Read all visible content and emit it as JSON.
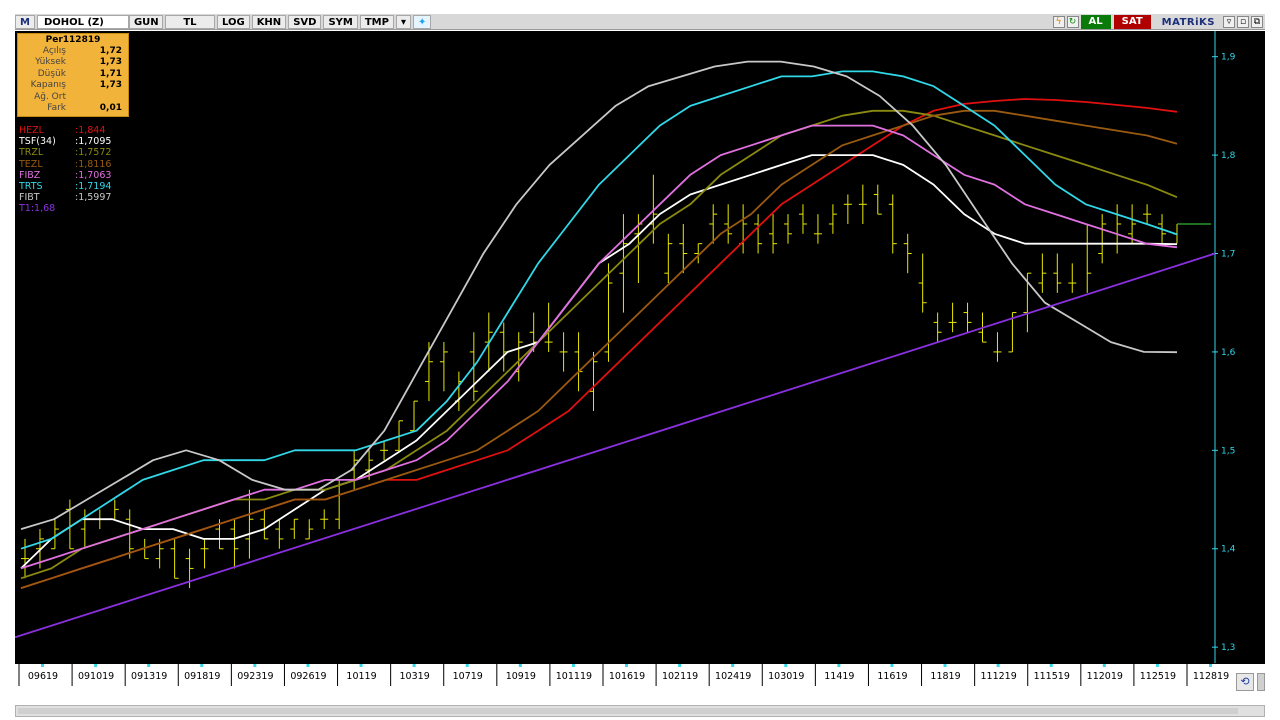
{
  "toolbar": {
    "logo": "M",
    "symbol": "DOHOL (Z)",
    "period": "GUN",
    "currency": "TL",
    "log": "LOG",
    "khn": "KHN",
    "svd": "SVD",
    "sym": "SYM",
    "tmp": "TMP",
    "buy": "AL",
    "sell": "SAT",
    "brand": "MATRiKS"
  },
  "info_box": {
    "title": "Per112819",
    "rows": [
      {
        "label": "Açılış",
        "value": "1,72"
      },
      {
        "label": "Yüksek",
        "value": "1,73"
      },
      {
        "label": "Düşük",
        "value": "1,71"
      },
      {
        "label": "Kapanış",
        "value": "1,73"
      },
      {
        "label": "Ağ. Ort",
        "value": ""
      },
      {
        "label": "Fark",
        "value": "0,01"
      }
    ]
  },
  "legend": [
    {
      "name": "HEZL",
      "value": ":1,844",
      "color": "#e01010"
    },
    {
      "name": "TSF(34)",
      "value": ":1,7095",
      "color": "#ffffff"
    },
    {
      "name": "TRZL",
      "value": ":1,7572",
      "color": "#8a8a10"
    },
    {
      "name": "TEZL",
      "value": ":1,8116",
      "color": "#9a5a10"
    },
    {
      "name": "FIBZ",
      "value": ":1,7063",
      "color": "#e070e0"
    },
    {
      "name": "TRTS",
      "value": ":1,7194",
      "color": "#30d8e8"
    },
    {
      "name": "FIBT",
      "value": ":1,5997",
      "color": "#c8c8c8"
    },
    {
      "name": "T1:1,68",
      "value": "",
      "color": "#8a30e0"
    }
  ],
  "chart_data": {
    "type": "line",
    "ylim": [
      1.29,
      1.92
    ],
    "y_ticks": [
      "1,9",
      "1,8",
      "1,7",
      "1,6",
      "1,5",
      "1,4",
      "1,3"
    ],
    "y_tick_values": [
      1.9,
      1.8,
      1.7,
      1.6,
      1.5,
      1.4,
      1.3
    ],
    "x_tick_labels": [
      "09619",
      "091019",
      "091319",
      "091819",
      "092319",
      "092619",
      "10119",
      "10319",
      "10719",
      "10919",
      "101119",
      "101619",
      "102119",
      "102419",
      "103019",
      "11419",
      "11619",
      "11819",
      "111219",
      "111519",
      "112019",
      "112519",
      "112819"
    ],
    "bar_color": "#e8e800",
    "ohlc": [
      [
        1.39,
        1.41,
        1.37,
        1.39
      ],
      [
        1.4,
        1.42,
        1.38,
        1.41
      ],
      [
        1.4,
        1.43,
        1.4,
        1.42
      ],
      [
        1.44,
        1.45,
        1.4,
        1.4
      ],
      [
        1.42,
        1.44,
        1.4,
        1.43
      ],
      [
        1.43,
        1.44,
        1.42,
        1.43
      ],
      [
        1.43,
        1.45,
        1.43,
        1.44
      ],
      [
        1.43,
        1.44,
        1.39,
        1.4
      ],
      [
        1.4,
        1.41,
        1.39,
        1.39
      ],
      [
        1.39,
        1.41,
        1.38,
        1.4
      ],
      [
        1.4,
        1.41,
        1.37,
        1.37
      ],
      [
        1.39,
        1.4,
        1.36,
        1.38
      ],
      [
        1.4,
        1.41,
        1.38,
        1.4
      ],
      [
        1.42,
        1.43,
        1.4,
        1.4
      ],
      [
        1.42,
        1.43,
        1.38,
        1.4
      ],
      [
        1.41,
        1.46,
        1.39,
        1.43
      ],
      [
        1.43,
        1.44,
        1.41,
        1.41
      ],
      [
        1.42,
        1.43,
        1.4,
        1.41
      ],
      [
        1.42,
        1.43,
        1.41,
        1.43
      ],
      [
        1.41,
        1.43,
        1.41,
        1.42
      ],
      [
        1.43,
        1.44,
        1.42,
        1.43
      ],
      [
        1.43,
        1.47,
        1.42,
        1.47
      ],
      [
        1.48,
        1.5,
        1.46,
        1.49
      ],
      [
        1.48,
        1.5,
        1.47,
        1.49
      ],
      [
        1.5,
        1.51,
        1.49,
        1.5
      ],
      [
        1.5,
        1.53,
        1.5,
        1.53
      ],
      [
        1.52,
        1.55,
        1.52,
        1.55
      ],
      [
        1.57,
        1.61,
        1.55,
        1.59
      ],
      [
        1.59,
        1.61,
        1.56,
        1.6
      ],
      [
        1.55,
        1.58,
        1.54,
        1.57
      ],
      [
        1.6,
        1.62,
        1.55,
        1.56
      ],
      [
        1.61,
        1.64,
        1.58,
        1.62
      ],
      [
        1.62,
        1.63,
        1.58,
        1.6
      ],
      [
        1.58,
        1.62,
        1.57,
        1.61
      ],
      [
        1.62,
        1.64,
        1.6,
        1.61
      ],
      [
        1.61,
        1.65,
        1.6,
        1.61
      ],
      [
        1.6,
        1.62,
        1.58,
        1.6
      ],
      [
        1.6,
        1.62,
        1.56,
        1.58
      ],
      [
        1.56,
        1.6,
        1.54,
        1.59
      ],
      [
        1.6,
        1.69,
        1.59,
        1.67
      ],
      [
        1.68,
        1.74,
        1.64,
        1.71
      ],
      [
        1.72,
        1.74,
        1.67,
        1.73
      ],
      [
        1.73,
        1.78,
        1.71,
        1.74
      ],
      [
        1.68,
        1.72,
        1.67,
        1.71
      ],
      [
        1.71,
        1.73,
        1.68,
        1.7
      ],
      [
        1.7,
        1.71,
        1.69,
        1.71
      ],
      [
        1.73,
        1.75,
        1.71,
        1.74
      ],
      [
        1.73,
        1.75,
        1.71,
        1.72
      ],
      [
        1.71,
        1.75,
        1.7,
        1.73
      ],
      [
        1.73,
        1.74,
        1.7,
        1.71
      ],
      [
        1.72,
        1.74,
        1.7,
        1.71
      ],
      [
        1.73,
        1.74,
        1.71,
        1.72
      ],
      [
        1.74,
        1.75,
        1.72,
        1.73
      ],
      [
        1.72,
        1.74,
        1.71,
        1.72
      ],
      [
        1.73,
        1.75,
        1.72,
        1.74
      ],
      [
        1.75,
        1.76,
        1.73,
        1.75
      ],
      [
        1.75,
        1.77,
        1.73,
        1.75
      ],
      [
        1.76,
        1.77,
        1.74,
        1.74
      ],
      [
        1.75,
        1.76,
        1.7,
        1.71
      ],
      [
        1.71,
        1.72,
        1.68,
        1.7
      ],
      [
        1.67,
        1.7,
        1.64,
        1.65
      ],
      [
        1.63,
        1.64,
        1.61,
        1.62
      ],
      [
        1.63,
        1.65,
        1.62,
        1.63
      ],
      [
        1.64,
        1.65,
        1.62,
        1.63
      ],
      [
        1.62,
        1.64,
        1.61,
        1.61
      ],
      [
        1.6,
        1.62,
        1.59,
        1.6
      ],
      [
        1.6,
        1.64,
        1.6,
        1.64
      ],
      [
        1.64,
        1.68,
        1.62,
        1.68
      ],
      [
        1.67,
        1.7,
        1.66,
        1.68
      ],
      [
        1.68,
        1.7,
        1.66,
        1.67
      ],
      [
        1.67,
        1.69,
        1.66,
        1.67
      ],
      [
        1.71,
        1.73,
        1.66,
        1.68
      ],
      [
        1.7,
        1.74,
        1.69,
        1.73
      ],
      [
        1.71,
        1.75,
        1.7,
        1.73
      ],
      [
        1.72,
        1.75,
        1.71,
        1.73
      ],
      [
        1.74,
        1.75,
        1.73,
        1.74
      ],
      [
        1.73,
        1.74,
        1.71,
        1.72
      ],
      [
        1.72,
        1.73,
        1.71,
        1.73
      ]
    ],
    "series": [
      {
        "name": "HEZL",
        "color": "#e01010",
        "values": [
          1.36,
          1.37,
          1.38,
          1.39,
          1.4,
          1.41,
          1.42,
          1.43,
          1.44,
          1.45,
          1.45,
          1.46,
          1.47,
          1.47,
          1.48,
          1.49,
          1.5,
          1.52,
          1.54,
          1.57,
          1.6,
          1.63,
          1.66,
          1.69,
          1.72,
          1.75,
          1.77,
          1.79,
          1.81,
          1.83,
          1.845,
          1.852,
          1.855,
          1.857,
          1.856,
          1.854,
          1.851,
          1.848,
          1.844
        ]
      },
      {
        "name": "TSF(34)",
        "color": "#ffffff",
        "values": [
          1.38,
          1.41,
          1.43,
          1.43,
          1.42,
          1.42,
          1.41,
          1.41,
          1.42,
          1.44,
          1.46,
          1.47,
          1.49,
          1.51,
          1.54,
          1.57,
          1.6,
          1.61,
          1.65,
          1.69,
          1.71,
          1.74,
          1.76,
          1.77,
          1.78,
          1.79,
          1.8,
          1.8,
          1.8,
          1.79,
          1.77,
          1.74,
          1.72,
          1.71,
          1.71,
          1.71,
          1.71,
          1.71,
          1.7095
        ]
      },
      {
        "name": "TRZL",
        "color": "#8a8a10",
        "values": [
          1.37,
          1.38,
          1.4,
          1.41,
          1.42,
          1.43,
          1.44,
          1.45,
          1.45,
          1.46,
          1.46,
          1.47,
          1.48,
          1.5,
          1.52,
          1.55,
          1.58,
          1.61,
          1.64,
          1.67,
          1.7,
          1.73,
          1.75,
          1.78,
          1.8,
          1.82,
          1.83,
          1.84,
          1.845,
          1.845,
          1.84,
          1.83,
          1.82,
          1.81,
          1.8,
          1.79,
          1.78,
          1.77,
          1.7572
        ]
      },
      {
        "name": "TEZL",
        "color": "#9a5a10",
        "values": [
          1.36,
          1.37,
          1.38,
          1.39,
          1.4,
          1.41,
          1.42,
          1.43,
          1.44,
          1.45,
          1.45,
          1.46,
          1.47,
          1.48,
          1.49,
          1.5,
          1.52,
          1.54,
          1.57,
          1.6,
          1.63,
          1.66,
          1.69,
          1.72,
          1.74,
          1.77,
          1.79,
          1.81,
          1.82,
          1.83,
          1.84,
          1.845,
          1.845,
          1.84,
          1.835,
          1.83,
          1.825,
          1.82,
          1.8116
        ]
      },
      {
        "name": "FIBZ",
        "color": "#e070e0",
        "values": [
          1.38,
          1.39,
          1.4,
          1.41,
          1.42,
          1.43,
          1.44,
          1.45,
          1.46,
          1.46,
          1.47,
          1.47,
          1.48,
          1.49,
          1.51,
          1.54,
          1.57,
          1.61,
          1.65,
          1.69,
          1.72,
          1.75,
          1.78,
          1.8,
          1.81,
          1.82,
          1.83,
          1.83,
          1.83,
          1.82,
          1.8,
          1.78,
          1.77,
          1.75,
          1.74,
          1.73,
          1.72,
          1.71,
          1.7063
        ]
      },
      {
        "name": "TRTS",
        "color": "#30d8e8",
        "values": [
          1.4,
          1.41,
          1.43,
          1.45,
          1.47,
          1.48,
          1.49,
          1.49,
          1.49,
          1.5,
          1.5,
          1.5,
          1.51,
          1.52,
          1.55,
          1.59,
          1.64,
          1.69,
          1.73,
          1.77,
          1.8,
          1.83,
          1.85,
          1.86,
          1.87,
          1.88,
          1.88,
          1.885,
          1.885,
          1.88,
          1.87,
          1.85,
          1.83,
          1.8,
          1.77,
          1.75,
          1.74,
          1.73,
          1.7194
        ]
      },
      {
        "name": "FIBT",
        "color": "#c8c8c8",
        "values": [
          1.42,
          1.43,
          1.45,
          1.47,
          1.49,
          1.5,
          1.49,
          1.47,
          1.46,
          1.46,
          1.48,
          1.52,
          1.58,
          1.64,
          1.7,
          1.75,
          1.79,
          1.82,
          1.85,
          1.87,
          1.88,
          1.89,
          1.895,
          1.895,
          1.89,
          1.88,
          1.86,
          1.83,
          1.79,
          1.74,
          1.69,
          1.65,
          1.63,
          1.61,
          1.6,
          1.5997
        ]
      },
      {
        "name": "T1",
        "color": "#8a30e0",
        "values": [
          1.31,
          1.7
        ]
      }
    ],
    "last_bar_marker": {
      "value": 1.73,
      "color": "#30b030"
    }
  }
}
